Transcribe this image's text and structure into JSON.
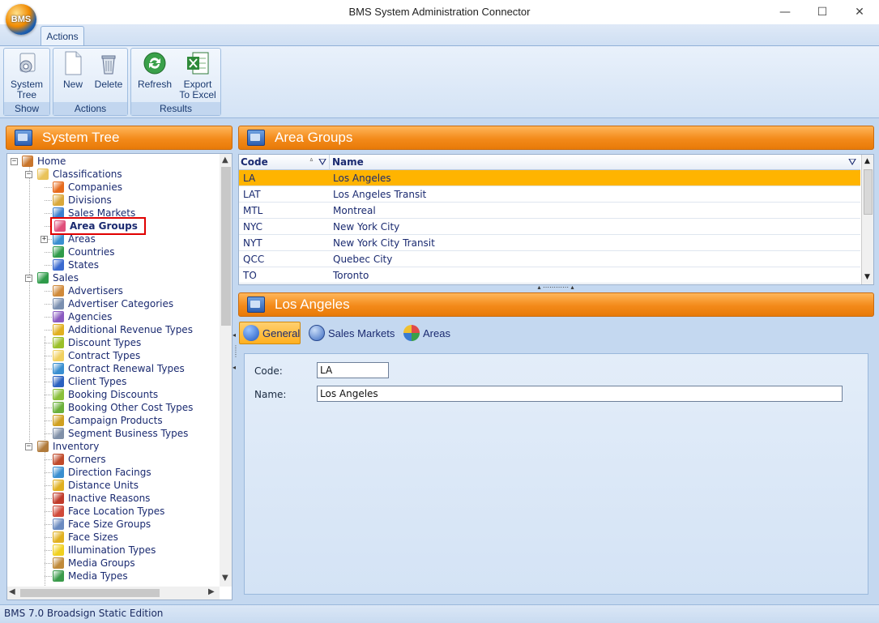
{
  "window": {
    "title": "BMS System Administration Connector",
    "logo_text": "BMS",
    "minimize": "—",
    "maximize": "☐",
    "close": "✕"
  },
  "ribbon": {
    "tab": "Actions",
    "groups": {
      "show": {
        "label": "Show",
        "system_tree_line1": "System",
        "system_tree_line2": "Tree"
      },
      "actions": {
        "label": "Actions",
        "new": "New",
        "delete": "Delete"
      },
      "results": {
        "label": "Results",
        "refresh": "Refresh",
        "export_line1": "Export",
        "export_line2": "To Excel"
      }
    }
  },
  "system_tree": {
    "title": "System Tree",
    "nodes": [
      {
        "label": "Home",
        "icon": "home-icon",
        "color": "#c8742a"
      },
      {
        "label": "Classifications",
        "icon": "folder-icon",
        "color": "#e9c35a"
      },
      {
        "label": "Companies",
        "icon": "flag-icon",
        "color": "#e66a1c"
      },
      {
        "label": "Divisions",
        "icon": "divisions-icon",
        "color": "#d9a83a"
      },
      {
        "label": "Sales Markets",
        "icon": "globe-icon",
        "color": "#3a7fd0"
      },
      {
        "label": "Area Groups",
        "icon": "area-groups-icon",
        "color": "#e04f7a"
      },
      {
        "label": "Areas",
        "icon": "globe-icon",
        "color": "#3a8fd0"
      },
      {
        "label": "Countries",
        "icon": "globe-icon",
        "color": "#2f9b4a"
      },
      {
        "label": "States",
        "icon": "states-icon",
        "color": "#3a6ad0"
      },
      {
        "label": "Sales",
        "icon": "sales-icon",
        "color": "#2f9b4a"
      },
      {
        "label": "Advertisers",
        "icon": "person-icon",
        "color": "#d08a3a"
      },
      {
        "label": "Advertiser Categories",
        "icon": "categories-icon",
        "color": "#7a8fb0"
      },
      {
        "label": "Agencies",
        "icon": "person-icon",
        "color": "#8a5ac0"
      },
      {
        "label": "Additional Revenue Types",
        "icon": "coin-icon",
        "color": "#e0b020"
      },
      {
        "label": "Discount Types",
        "icon": "tag-icon",
        "color": "#9ac02a"
      },
      {
        "label": "Contract Types",
        "icon": "document-icon",
        "color": "#f0d060"
      },
      {
        "label": "Contract Renewal Types",
        "icon": "renew-icon",
        "color": "#3a8fd0"
      },
      {
        "label": "Client Types",
        "icon": "client-icon",
        "color": "#2a60c0"
      },
      {
        "label": "Booking Discounts",
        "icon": "tag-icon",
        "color": "#8ac03a"
      },
      {
        "label": "Booking Other Cost Types",
        "icon": "tag-icon",
        "color": "#6ab03a"
      },
      {
        "label": "Campaign Products",
        "icon": "box-icon",
        "color": "#d0a020"
      },
      {
        "label": "Segment Business Types",
        "icon": "list-icon",
        "color": "#8090a8"
      },
      {
        "label": "Inventory",
        "icon": "inventory-icon",
        "color": "#b07a3a"
      },
      {
        "label": "Corners",
        "icon": "corners-icon",
        "color": "#c04a2a"
      },
      {
        "label": "Direction Facings",
        "icon": "direction-icon",
        "color": "#3a8fd0"
      },
      {
        "label": "Distance Units",
        "icon": "distance-icon",
        "color": "#e0b020"
      },
      {
        "label": "Inactive Reasons",
        "icon": "traffic-light-icon",
        "color": "#c03a2a"
      },
      {
        "label": "Face Location Types",
        "icon": "location-icon",
        "color": "#d04a3a"
      },
      {
        "label": "Face Size Groups",
        "icon": "size-icon",
        "color": "#6a8ac0"
      },
      {
        "label": "Face Sizes",
        "icon": "size-icon",
        "color": "#e0b020"
      },
      {
        "label": "Illumination Types",
        "icon": "bulb-icon",
        "color": "#f0d020"
      },
      {
        "label": "Media Groups",
        "icon": "media-icon",
        "color": "#c08a3a"
      },
      {
        "label": "Media Types",
        "icon": "media-icon",
        "color": "#3a9a4a"
      }
    ]
  },
  "area_groups": {
    "title": "Area Groups",
    "columns": {
      "code": "Code",
      "name": "Name"
    },
    "rows": [
      {
        "code": "LA",
        "name": "Los Angeles"
      },
      {
        "code": "LAT",
        "name": "Los Angeles Transit"
      },
      {
        "code": "MTL",
        "name": "Montreal"
      },
      {
        "code": "NYC",
        "name": "New York City"
      },
      {
        "code": "NYT",
        "name": "New York City Transit"
      },
      {
        "code": "QCC",
        "name": "Quebec City"
      },
      {
        "code": "TO",
        "name": "Toronto"
      }
    ]
  },
  "detail": {
    "title": "Los Angeles",
    "tabs": {
      "general": "General",
      "sales_markets": "Sales Markets",
      "areas": "Areas"
    },
    "form": {
      "code_label": "Code:",
      "code_value": "LA",
      "name_label": "Name:",
      "name_value": "Los Angeles"
    }
  },
  "status": {
    "text": "BMS 7.0 Broadsign Static Edition"
  },
  "colors": {
    "header_orange": "#f38a1a",
    "selection": "#ffb400",
    "highlight_box": "#e00000"
  }
}
